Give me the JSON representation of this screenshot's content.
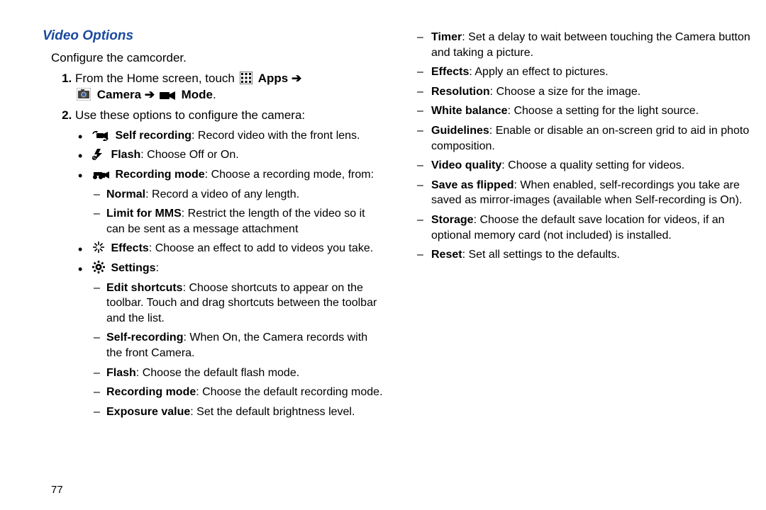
{
  "heading": "Video Options",
  "intro": "Configure the camcorder.",
  "step1": {
    "lead": "From the Home screen, touch",
    "apps": "Apps",
    "arrow1": "➔",
    "camera": "Camera",
    "arrow2": "➔",
    "mode": "Mode",
    "period": "."
  },
  "step2": {
    "lead": "Use these options to configure the camera:"
  },
  "bul": {
    "selfrec": {
      "label": "Self recording",
      "desc": ": Record video with the front lens."
    },
    "flash": {
      "label": "Flash",
      "desc": ": Choose Off or On."
    },
    "recmode": {
      "label": "Recording mode",
      "desc": ": Choose a recording mode, from:"
    },
    "normal": {
      "label": "Normal",
      "desc": ": Record a video of any length."
    },
    "limitmms": {
      "label": "Limit for MMS",
      "desc": ": Restrict the length of the video so it can be sent as a message attachment"
    },
    "effects": {
      "label": "Effects",
      "desc": ": Choose an effect to add to videos you take."
    },
    "settings": {
      "label": "Settings",
      "desc": ":"
    },
    "editshort": {
      "label": "Edit shortcuts",
      "desc": ": Choose shortcuts to appear on the toolbar. Touch and drag shortcuts between the toolbar and the list."
    },
    "selfrec2": {
      "label": "Self-recording",
      "desc": ": When On, the Camera records with the front Camera."
    },
    "flash2": {
      "label": "Flash",
      "desc": ": Choose the default flash mode."
    },
    "recmode2": {
      "label": "Recording mode",
      "desc": ": Choose the default recording mode."
    },
    "expval": {
      "label": "Exposure value",
      "desc": ": Set the default brightness level."
    }
  },
  "right": {
    "timer": {
      "label": "Timer",
      "desc": ": Set a delay to wait between touching the Camera button and taking a picture."
    },
    "effects": {
      "label": "Effects",
      "desc": ": Apply an effect to pictures."
    },
    "resolution": {
      "label": "Resolution",
      "desc": ": Choose a size for the image."
    },
    "whitebal": {
      "label": "White balance",
      "desc": ": Choose a setting for the light source."
    },
    "guidelines": {
      "label": "Guidelines",
      "desc": ": Enable or disable an on-screen grid to aid in photo composition."
    },
    "vidqual": {
      "label": "Video quality",
      "desc": ": Choose a quality setting for videos."
    },
    "saveflip": {
      "label": "Save as flipped",
      "desc": ": When enabled, self-recordings you take are saved as mirror-images (available when Self-recording is On)."
    },
    "storage": {
      "label": "Storage",
      "desc": ": Choose the default save location for videos, if an optional memory card (not included) is installed."
    },
    "reset": {
      "label": "Reset",
      "desc": ": Set all settings to the defaults."
    }
  },
  "page_number": "77"
}
